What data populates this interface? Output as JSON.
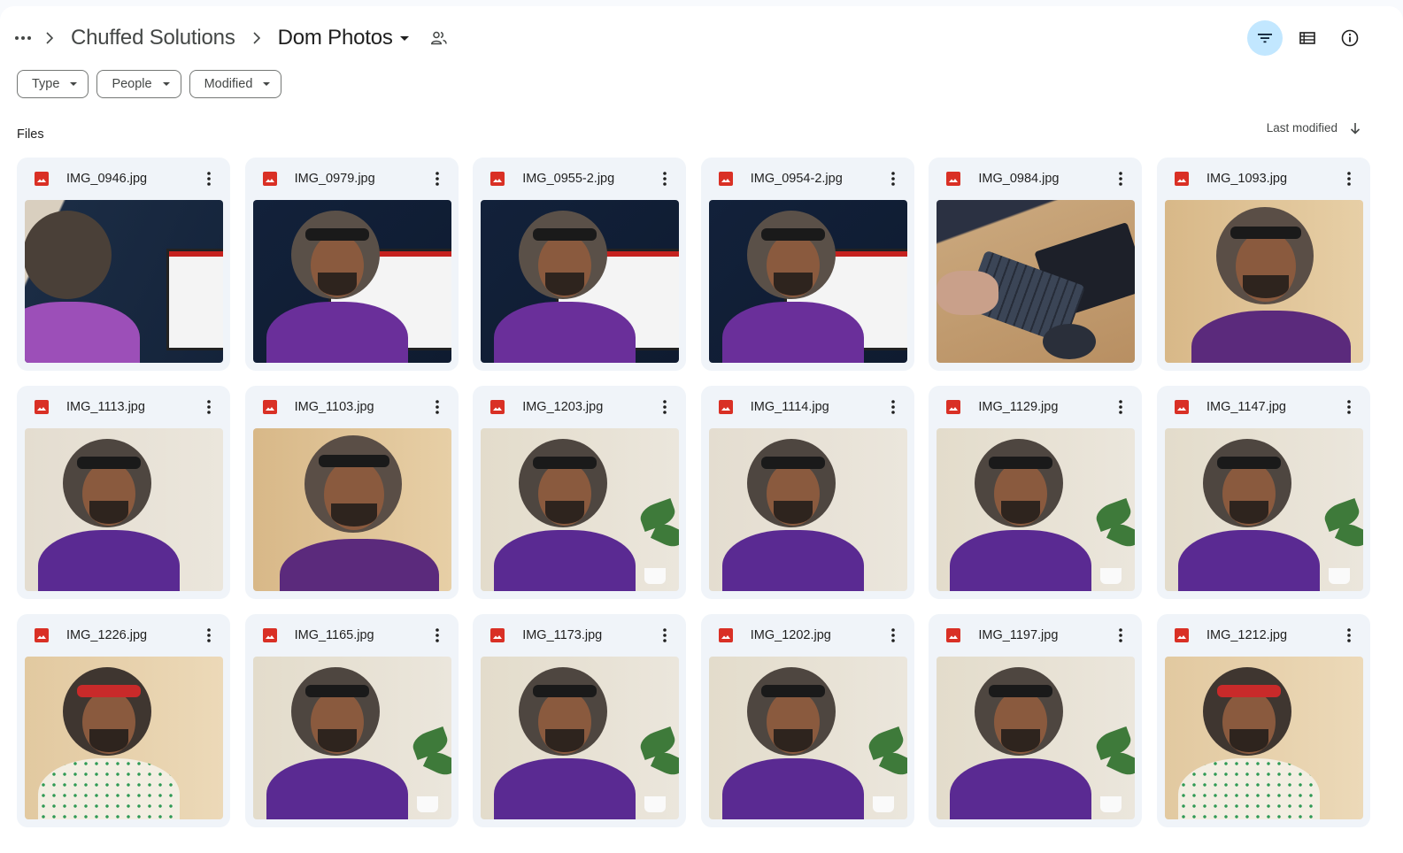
{
  "breadcrumb": {
    "more_label": "More folders",
    "parent": "Chuffed Solutions",
    "current": "Dom Photos"
  },
  "toolbar": {
    "filter_tooltip": "Hide search filters",
    "list_view_tooltip": "Switch to list layout",
    "details_tooltip": "View details"
  },
  "filters": [
    {
      "label": "Type"
    },
    {
      "label": "People"
    },
    {
      "label": "Modified"
    }
  ],
  "files_section": {
    "label": "Files",
    "sort_label": "Last modified",
    "sort_direction": "descending"
  },
  "colors": {
    "accent_active": "#c2e7ff",
    "card_bg": "#f0f4f9",
    "image_icon": "#d93025",
    "shirt_purple": "#5b2a8c"
  },
  "files": [
    {
      "name": "IMG_0946.jpg",
      "thumb": "office-dark-back"
    },
    {
      "name": "IMG_0979.jpg",
      "thumb": "office-dark"
    },
    {
      "name": "IMG_0955-2.jpg",
      "thumb": "office-dark"
    },
    {
      "name": "IMG_0954-2.jpg",
      "thumb": "office-dark"
    },
    {
      "name": "IMG_0984.jpg",
      "thumb": "desk-keyboard"
    },
    {
      "name": "IMG_1093.jpg",
      "thumb": "warm-phone"
    },
    {
      "name": "IMG_1113.jpg",
      "thumb": "light-desk"
    },
    {
      "name": "IMG_1103.jpg",
      "thumb": "warm-phone"
    },
    {
      "name": "IMG_1203.jpg",
      "thumb": "light-plant"
    },
    {
      "name": "IMG_1114.jpg",
      "thumb": "light-desk"
    },
    {
      "name": "IMG_1129.jpg",
      "thumb": "light-plant"
    },
    {
      "name": "IMG_1147.jpg",
      "thumb": "light-plant"
    },
    {
      "name": "IMG_1226.jpg",
      "thumb": "warm-redband"
    },
    {
      "name": "IMG_1165.jpg",
      "thumb": "light-plant"
    },
    {
      "name": "IMG_1173.jpg",
      "thumb": "light-plant"
    },
    {
      "name": "IMG_1202.jpg",
      "thumb": "light-plant"
    },
    {
      "name": "IMG_1197.jpg",
      "thumb": "light-plant"
    },
    {
      "name": "IMG_1212.jpg",
      "thumb": "warm-redband"
    }
  ]
}
